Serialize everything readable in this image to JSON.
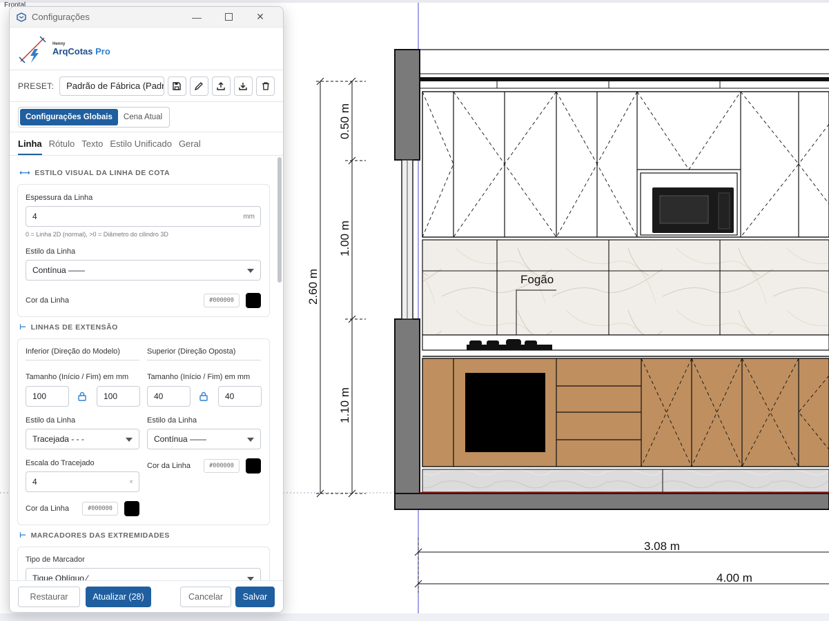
{
  "window": {
    "title": "Configurações"
  },
  "logo": {
    "small": "Henny",
    "main_a": "ArqCotas",
    "main_b": " Pro"
  },
  "preset": {
    "label": "PRESET:",
    "value": "Padrão de Fábrica (Padrã",
    "icons": [
      "save-icon",
      "edit-icon",
      "upload-icon",
      "download-icon",
      "trash-icon"
    ]
  },
  "scope": {
    "global": "Configurações Globais",
    "scene": "Cena Atual",
    "selected": "global"
  },
  "tabs": [
    {
      "label": "Linha",
      "active": true
    },
    {
      "label": "Rótulo",
      "active": false
    },
    {
      "label": "Texto",
      "active": false
    },
    {
      "label": "Estilo Unificado",
      "active": false
    },
    {
      "label": "Geral",
      "active": false
    }
  ],
  "visual": {
    "title": "ESTILO VISUAL DA LINHA DE COTA",
    "thickness_label": "Espessura da Linha",
    "thickness_value": "4",
    "thickness_unit": "mm",
    "thickness_hint": "0 = Linha 2D (normal), >0 = Diâmetro do cilindro 3D",
    "style_label": "Estilo da Linha",
    "style_value": "Contínua ——",
    "color_label": "Cor da Linha",
    "color_hex": "#000000"
  },
  "extension": {
    "title": "LINHAS DE EXTENSÃO",
    "lower": {
      "header": "Inferior (Direção do Modelo)",
      "size_label": "Tamanho (Início / Fim) em mm",
      "start": "100",
      "end": "100",
      "style_label": "Estilo da Linha",
      "style_value": "Tracejada - - -",
      "dash_label": "Escala do Tracejado",
      "dash_value": "4",
      "color_label": "Cor da Linha",
      "color_hex": "#000000"
    },
    "upper": {
      "header": "Superior (Direção Oposta)",
      "size_label": "Tamanho (Início / Fim) em mm",
      "start": "40",
      "end": "40",
      "style_label": "Estilo da Linha",
      "style_value": "Contínua ——",
      "color_label": "Cor da Linha",
      "color_hex": "#000000"
    }
  },
  "markers": {
    "title": "MARCADORES DAS EXTREMIDADES",
    "type_label": "Tipo de Marcador",
    "type_value": "Tique Oblíquo ⁄"
  },
  "footer": {
    "restore": "Restaurar",
    "update": "Atualizar (28)",
    "cancel": "Cancelar",
    "save": "Salvar"
  },
  "scene": {
    "corner_tag": "Frontal",
    "dim_upper": "0.50 m",
    "dim_middle": "1.00 m",
    "dim_lower": "1.10 m",
    "dim_total": "2.60 m",
    "dim_width_inner": "3.08 m",
    "dim_width_outer": "4.00 m",
    "label_stove": "Fogão"
  }
}
